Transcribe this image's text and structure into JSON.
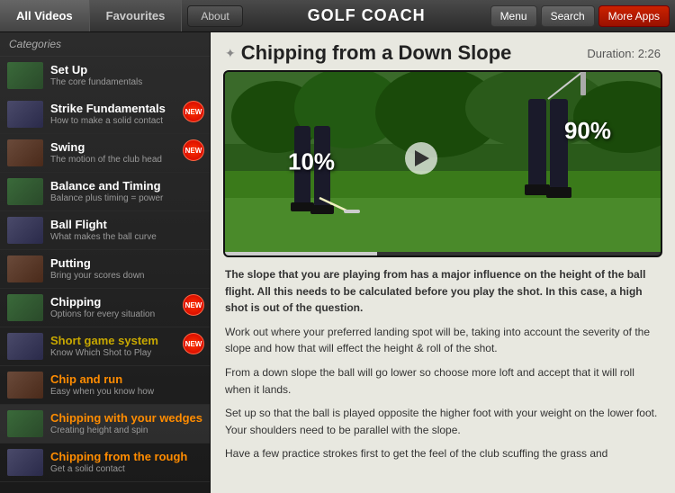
{
  "topNav": {
    "tab1": "All Videos",
    "tab2": "Favourites",
    "about": "About",
    "appTitle": "GOLF COACH",
    "menuBtn": "Menu",
    "searchBtn": "Search",
    "moreAppsBtn": "More Apps"
  },
  "sidebar": {
    "header": "Categories",
    "items": [
      {
        "id": "setup",
        "title": "Set Up",
        "subtitle": "The core fundamentals",
        "isNew": false,
        "titleColor": "white"
      },
      {
        "id": "strike",
        "title": "Strike Fundamentals",
        "subtitle": "How to make a solid contact",
        "isNew": true,
        "titleColor": "white"
      },
      {
        "id": "swing",
        "title": "Swing",
        "subtitle": "The motion of the club head",
        "isNew": true,
        "titleColor": "white"
      },
      {
        "id": "balance",
        "title": "Balance and Timing",
        "subtitle": "Balance plus timing = power",
        "isNew": false,
        "titleColor": "white"
      },
      {
        "id": "ballflight",
        "title": "Ball Flight",
        "subtitle": "What makes the ball curve",
        "isNew": false,
        "titleColor": "white"
      },
      {
        "id": "putting",
        "title": "Putting",
        "subtitle": "Bring your scores down",
        "isNew": false,
        "titleColor": "white"
      },
      {
        "id": "chipping",
        "title": "Chipping",
        "subtitle": "Options for every situation",
        "isNew": true,
        "titleColor": "white"
      },
      {
        "id": "shortgame",
        "title": "Short game system",
        "subtitle": "Know Which Shot to Play",
        "isNew": true,
        "titleColor": "gold"
      },
      {
        "id": "chiprun",
        "title": "Chip and run",
        "subtitle": "Easy when you know how",
        "isNew": false,
        "titleColor": "orange"
      },
      {
        "id": "wedges",
        "title": "Chipping with your wedges",
        "subtitle": "Creating height and spin",
        "isNew": false,
        "titleColor": "orange"
      },
      {
        "id": "rough",
        "title": "Chipping from the rough",
        "subtitle": "Get a solid contact",
        "isNew": false,
        "titleColor": "orange"
      }
    ]
  },
  "content": {
    "starIcon": "✦",
    "title": "Chipping from a Down Slope",
    "duration": "Duration: 2:26",
    "video": {
      "pct10": "10%",
      "pct90": "90%"
    },
    "paragraphs": [
      "The slope that you are playing from has a major influence on the height of the ball flight. All this needs to be calculated before you play the shot. In this case, a high shot is out of the question.",
      "Work out where your preferred landing spot will be, taking into account the severity of the slope and how that will effect the height & roll of the shot.",
      "From a down slope the ball will go lower so choose more loft and accept that it will roll when it lands.",
      "Set up so that the ball is played opposite the higher foot with your weight on the lower foot. Your shoulders need to be parallel with the slope.",
      "Have a few practice strokes first to get the feel of the club scuffing the grass and..."
    ]
  }
}
